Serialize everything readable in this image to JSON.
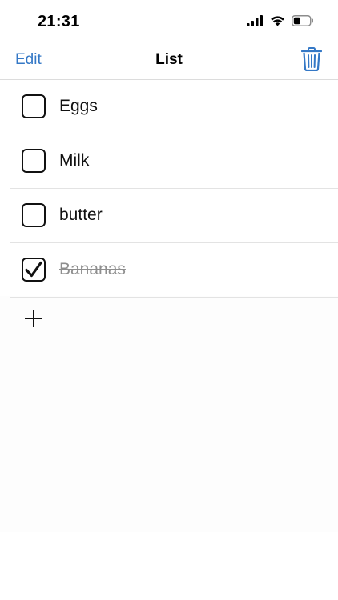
{
  "status_bar": {
    "time": "21:31",
    "icons": [
      "cellular-signal-icon",
      "wifi-icon",
      "battery-icon"
    ]
  },
  "nav": {
    "edit_label": "Edit",
    "title": "List",
    "trash_icon": "trash-icon"
  },
  "list": {
    "items": [
      {
        "label": "Eggs",
        "checked": false
      },
      {
        "label": "Milk",
        "checked": false
      },
      {
        "label": "butter",
        "checked": false
      },
      {
        "label": "Bananas",
        "checked": true
      }
    ]
  },
  "add_icon": "plus-icon",
  "colors": {
    "accent": "#3478c6",
    "text": "#111111",
    "done_text": "#8e8e8e",
    "divider": "#e3e3e3"
  }
}
